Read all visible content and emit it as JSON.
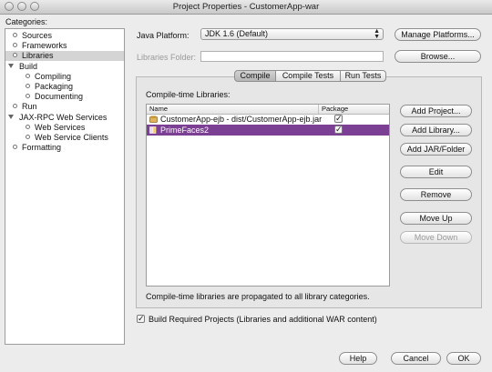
{
  "window": {
    "title": "Project Properties - CustomerApp-war"
  },
  "categories": {
    "label": "Categories:",
    "items": [
      {
        "label": "Sources",
        "kind": "leaf",
        "level": 1
      },
      {
        "label": "Frameworks",
        "kind": "leaf",
        "level": 1
      },
      {
        "label": "Libraries",
        "kind": "leaf",
        "level": 1,
        "selected": true
      },
      {
        "label": "Build",
        "kind": "group",
        "level": 0
      },
      {
        "label": "Compiling",
        "kind": "leaf",
        "level": 2
      },
      {
        "label": "Packaging",
        "kind": "leaf",
        "level": 2
      },
      {
        "label": "Documenting",
        "kind": "leaf",
        "level": 2
      },
      {
        "label": "Run",
        "kind": "leaf",
        "level": 1
      },
      {
        "label": "JAX-RPC Web Services",
        "kind": "group",
        "level": 0
      },
      {
        "label": "Web Services",
        "kind": "leaf",
        "level": 2
      },
      {
        "label": "Web Service Clients",
        "kind": "leaf",
        "level": 2
      },
      {
        "label": "Formatting",
        "kind": "leaf",
        "level": 1
      }
    ]
  },
  "platform": {
    "label": "Java Platform:",
    "value": "JDK 1.6 (Default)",
    "manage_label": "Manage Platforms..."
  },
  "libraries_folder": {
    "label": "Libraries Folder:",
    "value": "",
    "browse_label": "Browse..."
  },
  "tabs": [
    {
      "label": "Compile",
      "active": true
    },
    {
      "label": "Compile Tests",
      "active": false
    },
    {
      "label": "Run Tests",
      "active": false
    }
  ],
  "compile": {
    "section_label": "Compile-time Libraries:",
    "columns": {
      "name": "Name",
      "package": "Package"
    },
    "rows": [
      {
        "name": "CustomerApp-ejb - dist/CustomerApp-ejb.jar",
        "package": true,
        "icon": "project-jar-icon",
        "selected": false
      },
      {
        "name": "PrimeFaces2",
        "package": true,
        "icon": "library-icon",
        "selected": true
      }
    ],
    "note": "Compile-time libraries are propagated to all library categories."
  },
  "side_buttons": [
    {
      "label": "Add Project...",
      "name": "add-project-button",
      "enabled": true
    },
    {
      "label": "Add Library...",
      "name": "add-library-button",
      "enabled": true
    },
    {
      "label": "Add JAR/Folder",
      "name": "add-jar-folder-button",
      "enabled": true
    },
    {
      "label": "Edit",
      "name": "edit-button",
      "enabled": true
    },
    {
      "label": "Remove",
      "name": "remove-button",
      "enabled": true
    },
    {
      "label": "Move Up",
      "name": "move-up-button",
      "enabled": true
    },
    {
      "label": "Move Down",
      "name": "move-down-button",
      "enabled": false
    }
  ],
  "build_required": {
    "checked": true,
    "label": "Build Required Projects (Libraries and additional WAR content)"
  },
  "footer": {
    "help": "Help",
    "cancel": "Cancel",
    "ok": "OK"
  },
  "colors": {
    "selection": "#7b3f93",
    "background": "#ececec"
  }
}
